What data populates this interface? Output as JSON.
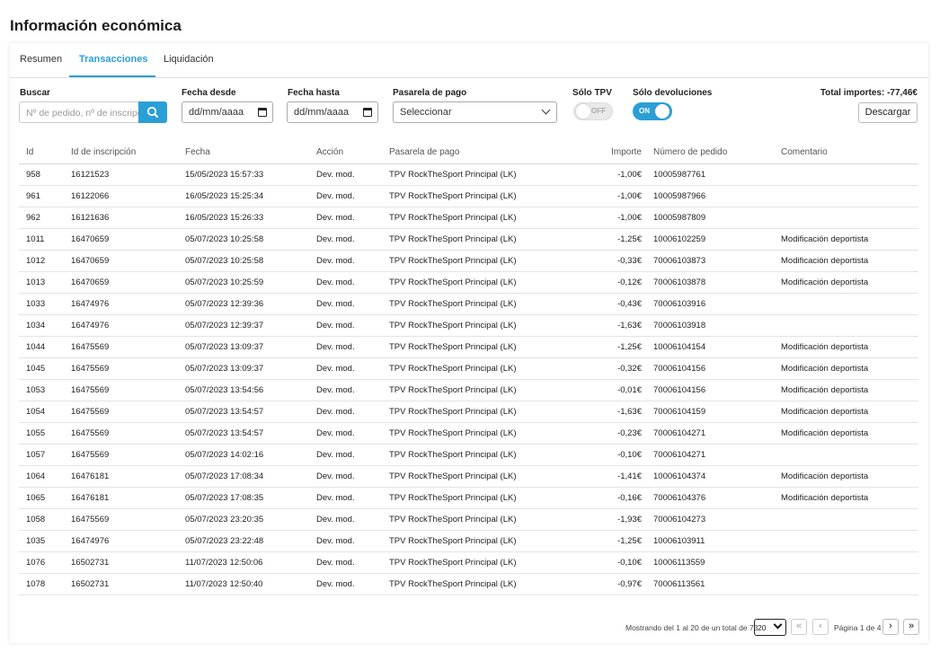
{
  "page": {
    "title": "Información económica"
  },
  "tabs": [
    {
      "label": "Resumen",
      "active": false
    },
    {
      "label": "Transacciones",
      "active": true
    },
    {
      "label": "Liquidación",
      "active": false
    }
  ],
  "filters": {
    "search_label": "Buscar",
    "search_placeholder": "Nº de pedido, nº de inscripción",
    "date_from_label": "Fecha desde",
    "date_from_value": "dd/mm/aaaa",
    "date_to_label": "Fecha hasta",
    "date_to_value": "dd/mm/aaaa",
    "gateway_label": "Pasarela de pago",
    "gateway_value": "Seleccionar",
    "tpv_label": "Sólo TPV",
    "tpv_state": "OFF",
    "refunds_label": "Sólo devoluciones",
    "refunds_state": "ON"
  },
  "summary": {
    "total_label": "Total importes: -77,46€",
    "download_label": "Descargar"
  },
  "accent_color": "#2a9fd6",
  "table": {
    "headers": [
      "Id",
      "Id de inscripción",
      "Fecha",
      "Acción",
      "Pasarela de pago",
      "Importe",
      "Número de pedido",
      "Comentario"
    ],
    "rows": [
      [
        "958",
        "16121523",
        "15/05/2023 15:57:33",
        "Dev. mod.",
        "TPV RockTheSport Principal (LK)",
        "-1,00€",
        "10005987761",
        ""
      ],
      [
        "961",
        "16122066",
        "16/05/2023 15:25:34",
        "Dev. mod.",
        "TPV RockTheSport Principal (LK)",
        "-1,00€",
        "10005987966",
        ""
      ],
      [
        "962",
        "16121636",
        "16/05/2023 15:26:33",
        "Dev. mod.",
        "TPV RockTheSport Principal (LK)",
        "-1,00€",
        "10005987809",
        ""
      ],
      [
        "1011",
        "16470659",
        "05/07/2023 10:25:58",
        "Dev. mod.",
        "TPV RockTheSport Principal (LK)",
        "-1,25€",
        "10006102259",
        "Modificación deportista"
      ],
      [
        "1012",
        "16470659",
        "05/07/2023 10:25:58",
        "Dev. mod.",
        "TPV RockTheSport Principal (LK)",
        "-0,33€",
        "70006103873",
        "Modificación deportista"
      ],
      [
        "1013",
        "16470659",
        "05/07/2023 10:25:59",
        "Dev. mod.",
        "TPV RockTheSport Principal (LK)",
        "-0,12€",
        "70006103878",
        "Modificación deportista"
      ],
      [
        "1033",
        "16474976",
        "05/07/2023 12:39:36",
        "Dev. mod.",
        "TPV RockTheSport Principal (LK)",
        "-0,43€",
        "70006103916",
        ""
      ],
      [
        "1034",
        "16474976",
        "05/07/2023 12:39:37",
        "Dev. mod.",
        "TPV RockTheSport Principal (LK)",
        "-1,63€",
        "70006103918",
        ""
      ],
      [
        "1044",
        "16475569",
        "05/07/2023 13:09:37",
        "Dev. mod.",
        "TPV RockTheSport Principal (LK)",
        "-1,25€",
        "10006104154",
        "Modificación deportista"
      ],
      [
        "1045",
        "16475569",
        "05/07/2023 13:09:37",
        "Dev. mod.",
        "TPV RockTheSport Principal (LK)",
        "-0,32€",
        "70006104156",
        "Modificación deportista"
      ],
      [
        "1053",
        "16475569",
        "05/07/2023 13:54:56",
        "Dev. mod.",
        "TPV RockTheSport Principal (LK)",
        "-0,01€",
        "70006104156",
        "Modificación deportista"
      ],
      [
        "1054",
        "16475569",
        "05/07/2023 13:54:57",
        "Dev. mod.",
        "TPV RockTheSport Principal (LK)",
        "-1,63€",
        "70006104159",
        "Modificación deportista"
      ],
      [
        "1055",
        "16475569",
        "05/07/2023 13:54:57",
        "Dev. mod.",
        "TPV RockTheSport Principal (LK)",
        "-0,23€",
        "70006104271",
        "Modificación deportista"
      ],
      [
        "1057",
        "16475569",
        "05/07/2023 14:02:16",
        "Dev. mod.",
        "TPV RockTheSport Principal (LK)",
        "-0,10€",
        "70006104271",
        ""
      ],
      [
        "1064",
        "16476181",
        "05/07/2023 17:08:34",
        "Dev. mod.",
        "TPV RockTheSport Principal (LK)",
        "-1,41€",
        "10006104374",
        "Modificación deportista"
      ],
      [
        "1065",
        "16476181",
        "05/07/2023 17:08:35",
        "Dev. mod.",
        "TPV RockTheSport Principal (LK)",
        "-0,16€",
        "70006104376",
        "Modificación deportista"
      ],
      [
        "1058",
        "16475569",
        "05/07/2023 23:20:35",
        "Dev. mod.",
        "TPV RockTheSport Principal (LK)",
        "-1,93€",
        "70006104273",
        ""
      ],
      [
        "1035",
        "16474976",
        "05/07/2023 23:22:48",
        "Dev. mod.",
        "TPV RockTheSport Principal (LK)",
        "-1,25€",
        "10006103911",
        ""
      ],
      [
        "1076",
        "16502731",
        "11/07/2023 12:50:06",
        "Dev. mod.",
        "TPV RockTheSport Principal (LK)",
        "-0,10€",
        "10006113559",
        ""
      ],
      [
        "1078",
        "16502731",
        "11/07/2023 12:50:40",
        "Dev. mod.",
        "TPV RockTheSport Principal (LK)",
        "-0,97€",
        "70006113561",
        ""
      ]
    ]
  },
  "pagination": {
    "showing_text": "Mostrando del 1 al 20 de un total de 73",
    "page_size": "20",
    "page_info": "Página 1 de 4",
    "first_icon": "«",
    "prev_icon": "‹",
    "next_icon": "›",
    "last_icon": "»"
  }
}
